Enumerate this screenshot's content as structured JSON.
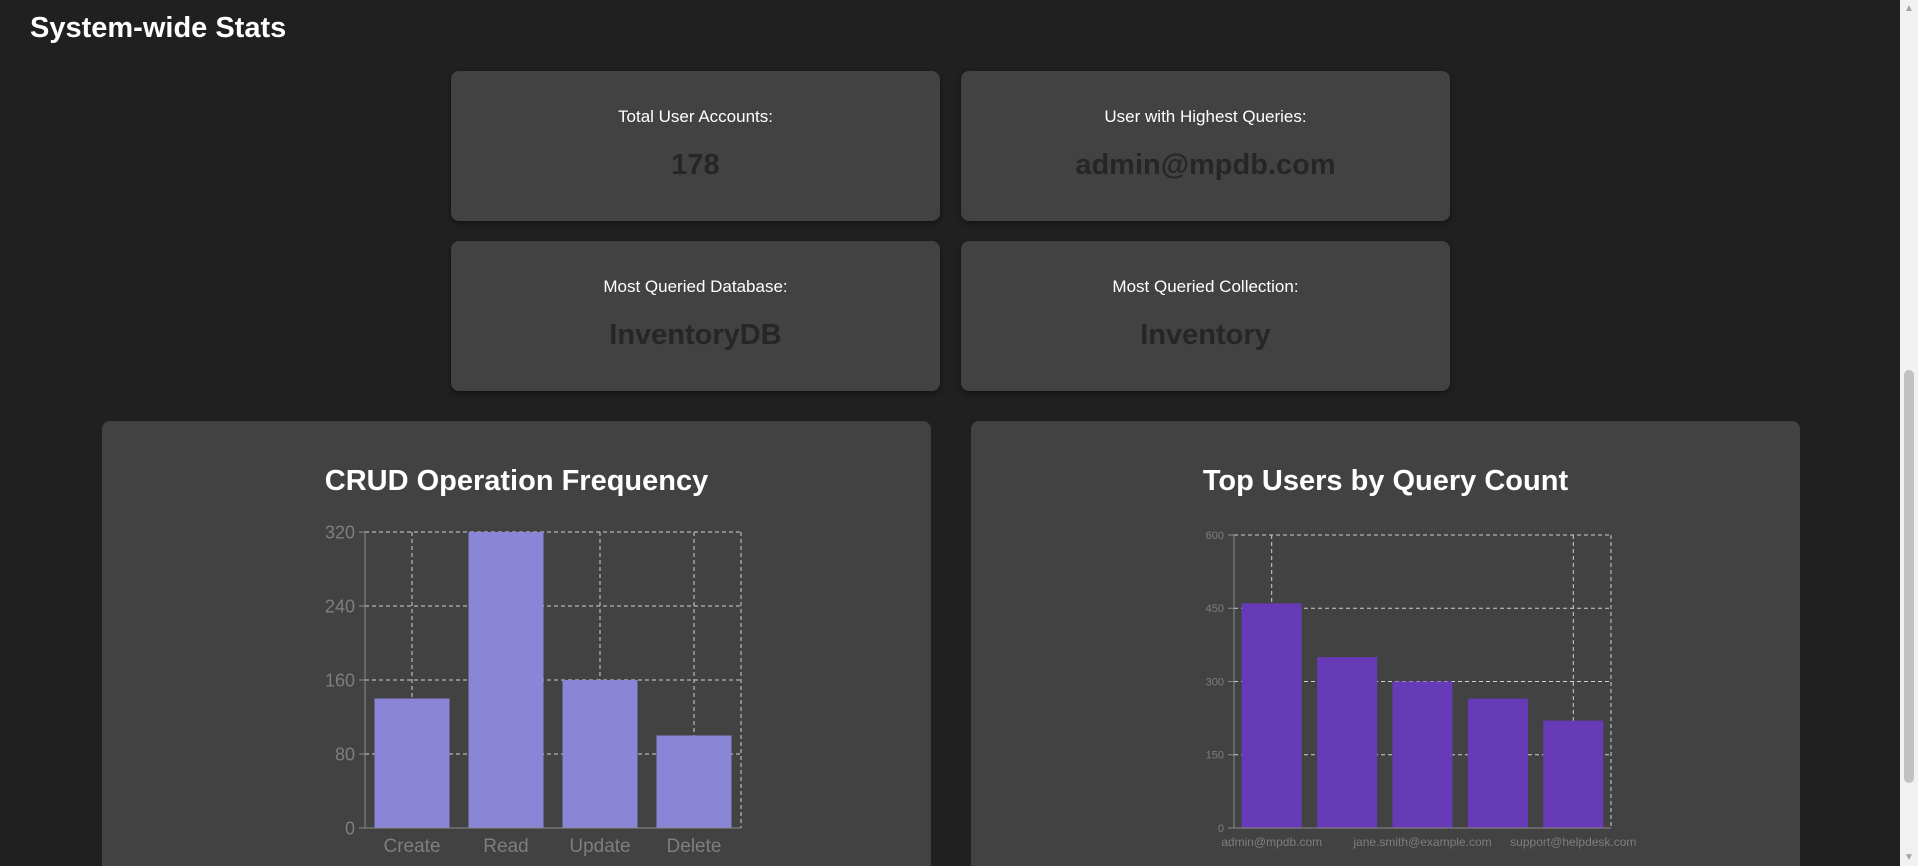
{
  "section": {
    "title": "System-wide Stats"
  },
  "stats": [
    {
      "label": "Total User Accounts:",
      "value": "178"
    },
    {
      "label": "User with Highest Queries:",
      "value": "admin@mpdb.com"
    },
    {
      "label": "Most Queried Database:",
      "value": "InventoryDB"
    },
    {
      "label": "Most Queried Collection:",
      "value": "Inventory"
    }
  ],
  "charts": {
    "crud": {
      "title": "CRUD Operation Frequency"
    },
    "users": {
      "title": "Top Users by Query Count"
    }
  },
  "colors": {
    "page_bg": "#202020",
    "card_bg": "#424242",
    "crud_bar": "#8b85d8",
    "user_bar": "#673ab7",
    "stat_value": "#262626"
  },
  "scrollbar": {
    "up_icon": "arrow-up",
    "down_icon": "arrow-down"
  },
  "chart_data": [
    {
      "type": "bar",
      "title": "CRUD Operation Frequency",
      "categories": [
        "Create",
        "Read",
        "Update",
        "Delete"
      ],
      "values": [
        140,
        320,
        160,
        100
      ],
      "xlabel": "",
      "ylabel": "",
      "ylim": [
        0,
        320
      ],
      "yticks": [
        0,
        80,
        160,
        240,
        320
      ],
      "grid": true,
      "color": "#8b85d8"
    },
    {
      "type": "bar",
      "title": "Top Users by Query Count",
      "categories": [
        "admin@mpdb.com",
        "",
        "jane.smith@example.com",
        "",
        "support@helpdesk.com"
      ],
      "values": [
        460,
        350,
        300,
        265,
        220
      ],
      "xlabel": "",
      "ylabel": "",
      "ylim": [
        0,
        600
      ],
      "yticks": [
        0,
        150,
        300,
        450,
        600
      ],
      "grid": true,
      "color": "#673ab7"
    }
  ]
}
